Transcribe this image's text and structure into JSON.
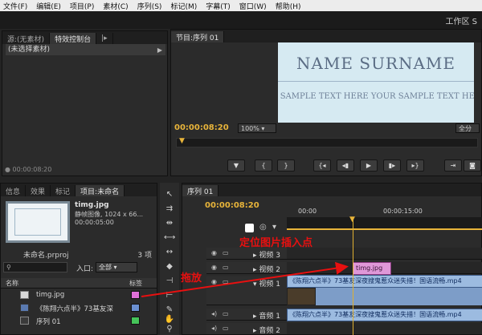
{
  "menu": [
    "文件(F)",
    "编辑(E)",
    "项目(P)",
    "素材(C)",
    "序列(S)",
    "标记(M)",
    "字幕(T)",
    "窗口(W)",
    "帮助(H)"
  ],
  "workspace": "工作区 S",
  "source_panel": {
    "tabs": [
      "源:(无素材)",
      "特效控制台",
      "|▸"
    ],
    "no_clip": "(未选择素材)",
    "timecode": "00:00:08:20"
  },
  "program_monitor": {
    "tab": "节目:序列 01",
    "title_text": "Name Surname",
    "sample_text": "R SAMPLE TEXT HERE YOUR SAMPLE TEXT HE",
    "timecode": "00:00:08:20",
    "zoom": "100%",
    "quality": "全分"
  },
  "project_panel": {
    "tabs": [
      "信息",
      "效果",
      "标记",
      "项目:未命名"
    ],
    "selected_file": {
      "name": "timg.jpg",
      "info": "静帧图像, 1024 x 66...",
      "duration": "00:00:05:00"
    },
    "project_name": "未命名.prproj",
    "item_count": "3 项",
    "entry_label": "入口:",
    "entry_value": "全部",
    "column_name": "名称",
    "column_label": "标签",
    "items": [
      {
        "name": "timg.jpg",
        "color": "#e070d8"
      },
      {
        "name": "《陈翔六点半》73基友深",
        "color": "#6a8fd0"
      },
      {
        "name": "序列 01",
        "color": "#46c45a"
      }
    ]
  },
  "timeline": {
    "tab": "序列 01",
    "timecode": "00:00:08:20",
    "ruler_labels": [
      "00:00",
      "00:00:15:00"
    ],
    "tracks": [
      {
        "name": "视频 3"
      },
      {
        "name": "视频 2"
      },
      {
        "name": "视频 1"
      },
      {
        "name": "音频 1"
      },
      {
        "name": "音频 2"
      }
    ],
    "clip_image": "timg.jpg",
    "clip_video": "《陈翔六点半》73基友深夜搜鬼惹众迷失措！国语流畅.mp4",
    "clip_audio": "《陈翔六点半》73基友深夜搜鬼惹众迷失措！国语流畅.mp4"
  },
  "annotations": {
    "insert_point": "定位图片插入点",
    "drag": "拖放",
    "color": "#e81010"
  }
}
